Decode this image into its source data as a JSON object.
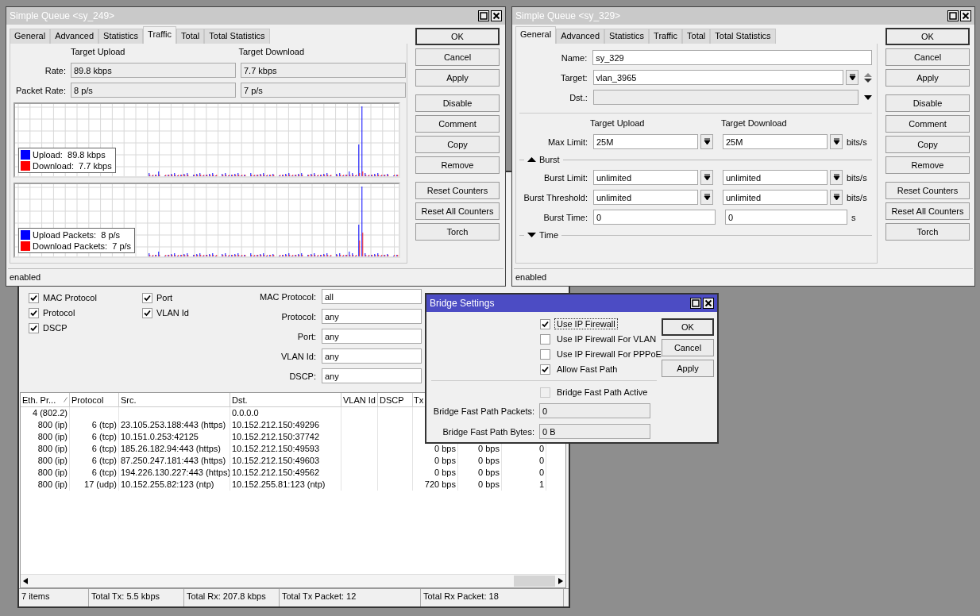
{
  "queue_traffic_window": {
    "title": "Simple Queue <sy_249>",
    "active": false,
    "tabs": [
      {
        "label": "General",
        "selected": false
      },
      {
        "label": "Advanced",
        "selected": false
      },
      {
        "label": "Statistics",
        "selected": false
      },
      {
        "label": "Traffic",
        "selected": true
      },
      {
        "label": "Total",
        "selected": false
      },
      {
        "label": "Total Statistics",
        "selected": false
      }
    ],
    "column_headers": [
      "Target Upload",
      "Target Download"
    ],
    "rows": [
      {
        "label": "Rate:",
        "upload": "89.8 kbps",
        "download": "7.7 kbps"
      },
      {
        "label": "Packet Rate:",
        "upload": "8 p/s",
        "download": "7 p/s"
      }
    ],
    "graphs": [
      {
        "legend": [
          {
            "label": "Upload:  89.8 kbps",
            "color": "#0000ff"
          },
          {
            "label": "Download:  7.7 kbps",
            "color": "#ff0000"
          }
        ]
      },
      {
        "legend": [
          {
            "label": "Upload Packets:  8 p/s",
            "color": "#0000ff"
          },
          {
            "label": "Download Packets:  7 p/s",
            "color": "#ff0000"
          }
        ]
      }
    ],
    "button_groups": [
      [
        {
          "label": "OK",
          "default": true
        },
        {
          "label": "Cancel",
          "default": false
        },
        {
          "label": "Apply",
          "default": false
        }
      ],
      [
        {
          "label": "Disable",
          "default": false
        },
        {
          "label": "Comment",
          "default": false
        },
        {
          "label": "Copy",
          "default": false
        },
        {
          "label": "Remove",
          "default": false
        }
      ],
      [
        {
          "label": "Reset Counters",
          "default": false
        },
        {
          "label": "Reset All Counters",
          "default": false
        },
        {
          "label": "Torch",
          "default": false
        }
      ]
    ],
    "status": "enabled"
  },
  "queue_general_window": {
    "title": "Simple Queue <sy_329>",
    "active": false,
    "tabs": [
      {
        "label": "General",
        "selected": true
      },
      {
        "label": "Advanced",
        "selected": false
      },
      {
        "label": "Statistics",
        "selected": false
      },
      {
        "label": "Traffic",
        "selected": false
      },
      {
        "label": "Total",
        "selected": false
      },
      {
        "label": "Total Statistics",
        "selected": false
      }
    ],
    "name": {
      "label": "Name:",
      "value": "sy_329"
    },
    "target": {
      "label": "Target:",
      "value": "vlan_3965"
    },
    "dst": {
      "label": "Dst.:"
    },
    "column_headers": [
      "Target Upload",
      "Target Download"
    ],
    "max_limit": {
      "label": "Max Limit:",
      "upload": "25M",
      "download": "25M",
      "unit": "bits/s"
    },
    "sections": [
      {
        "label": "Burst",
        "expanded": true,
        "rows": [
          {
            "label": "Burst Limit:",
            "upload": "unlimited",
            "download": "unlimited",
            "unit": "bits/s",
            "kind": "dropdown"
          },
          {
            "label": "Burst Threshold:",
            "upload": "unlimited",
            "download": "unlimited",
            "unit": "bits/s",
            "kind": "dropdown"
          },
          {
            "label": "Burst Time:",
            "upload": "0",
            "download": "0",
            "unit": "s",
            "kind": "text"
          }
        ]
      },
      {
        "label": "Time",
        "expanded": false
      }
    ],
    "button_groups": [
      [
        {
          "label": "OK",
          "default": true
        },
        {
          "label": "Cancel",
          "default": false
        },
        {
          "label": "Apply",
          "default": false
        }
      ],
      [
        {
          "label": "Disable",
          "default": false
        },
        {
          "label": "Comment",
          "default": false
        },
        {
          "label": "Copy",
          "default": false
        },
        {
          "label": "Remove",
          "default": false
        }
      ],
      [
        {
          "label": "Reset Counters",
          "default": false
        },
        {
          "label": "Reset All Counters",
          "default": false
        },
        {
          "label": "Torch",
          "default": false
        }
      ]
    ],
    "status": "enabled"
  },
  "connections_window": {
    "checkbox_columns": [
      [
        {
          "label": "MAC Protocol",
          "checked": true
        },
        {
          "label": "Protocol",
          "checked": true
        },
        {
          "label": "DSCP",
          "checked": true
        }
      ],
      [
        {
          "label": "Port",
          "checked": true
        },
        {
          "label": "VLAN Id",
          "checked": true
        }
      ]
    ],
    "fields": [
      {
        "label": "MAC Protocol:",
        "value": "all"
      },
      {
        "label": "Protocol:",
        "value": "any"
      },
      {
        "label": "Port:",
        "value": "any"
      },
      {
        "label": "VLAN Id:",
        "value": "any"
      },
      {
        "label": "DSCP:",
        "value": "any"
      }
    ],
    "table": {
      "columns": [
        "Eth. Pr...",
        "Protocol",
        "Src.",
        "Dst.",
        "VLAN Id",
        "DSCP",
        "Tx"
      ],
      "rows": [
        {
          "eth_protocol": "4 (802.2)",
          "dst": "0.0.0.0"
        },
        {
          "eth_protocol": "800 (ip)",
          "protocol": "6 (tcp)",
          "src": "23.105.253.188:443 (https)",
          "dst": "10.152.212.150:49296"
        },
        {
          "eth_protocol": "800 (ip)",
          "protocol": "6 (tcp)",
          "src": "10.151.0.253:42125",
          "dst": "10.152.212.150:37742"
        },
        {
          "eth_protocol": "800 (ip)",
          "protocol": "6 (tcp)",
          "src": "185.26.182.94:443 (https)",
          "dst": "10.152.212.150:49593",
          "tx": "0 bps",
          "column_8": "0 bps",
          "column_9": "0"
        },
        {
          "eth_protocol": "800 (ip)",
          "protocol": "6 (tcp)",
          "src": "87.250.247.181:443 (https)",
          "dst": "10.152.212.150:49603",
          "tx": "0 bps",
          "column_8": "0 bps",
          "column_9": "0"
        },
        {
          "eth_protocol": "800 (ip)",
          "protocol": "6 (tcp)",
          "src": "194.226.130.227:443 (https)",
          "dst": "10.152.212.150:49562",
          "tx": "0 bps",
          "column_8": "0 bps",
          "column_9": "0"
        },
        {
          "eth_protocol": "800 (ip)",
          "protocol": "17 (udp)",
          "src": "10.152.255.82:123 (ntp)",
          "dst": "10.152.255.81:123 (ntp)",
          "tx": "720 bps",
          "column_8": "0 bps",
          "column_9": "1"
        }
      ]
    },
    "status_bar": [
      "7 items",
      "Total Tx: 5.5 kbps",
      "Total Rx: 207.8 kbps",
      "Total Tx Packet: 12",
      "Total Rx Packet: 18"
    ]
  },
  "bridge_settings_window": {
    "title": "Bridge Settings",
    "active": true,
    "checkboxes": [
      {
        "label": "Use IP Firewall",
        "checked": true,
        "focused": true
      },
      {
        "label": "Use IP Firewall For VLAN",
        "checked": false,
        "focused": false
      },
      {
        "label": "Use IP Firewall For PPPoE",
        "checked": false,
        "focused": false
      },
      {
        "label": "Allow Fast Path",
        "checked": true,
        "focused": false
      }
    ],
    "fast_path_active": {
      "label": "Bridge Fast Path Active",
      "checked": false,
      "disabled": true
    },
    "fields": [
      {
        "label": "Bridge Fast Path Packets:",
        "value": "0"
      },
      {
        "label": "Bridge Fast Path Bytes:",
        "value": "0 B"
      }
    ],
    "buttons": [
      {
        "label": "OK",
        "default": true
      },
      {
        "label": "Cancel",
        "default": false
      },
      {
        "label": "Apply",
        "default": false
      }
    ]
  }
}
